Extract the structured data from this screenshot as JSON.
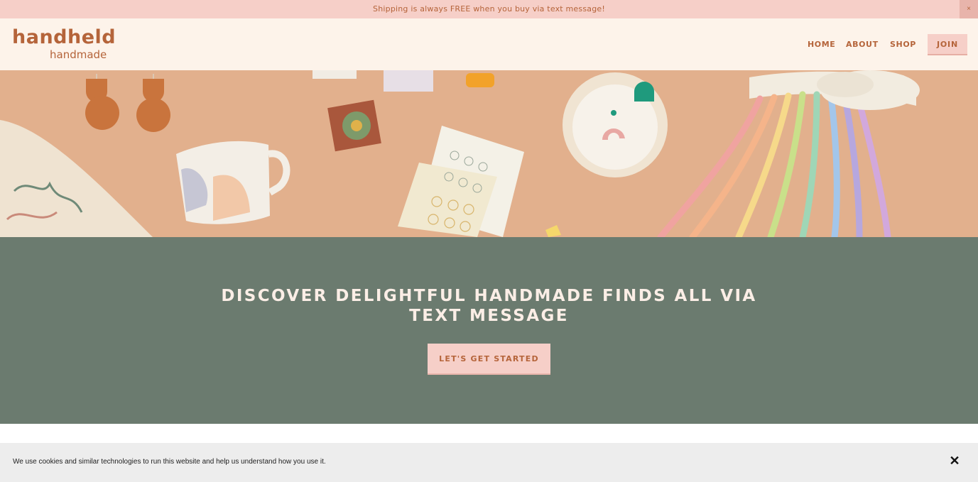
{
  "announcement": {
    "text": "Shipping is always FREE when you buy via text message!",
    "close_glyph": "×"
  },
  "header": {
    "logo_top": "handheld",
    "logo_bottom": "handmade",
    "nav": [
      "HOME",
      "ABOUT",
      "SHOP"
    ],
    "join_label": "JOIN"
  },
  "hero": {
    "image_alt": "Flat lay of handmade goods: leather earrings, ceramic mug, patterned cards, jewelry dish, rainbow yarn wall hanging",
    "background_color": "#e5b592"
  },
  "band": {
    "headline": "DISCOVER DELIGHTFUL HANDMADE FINDS ALL VIA TEXT MESSAGE",
    "cta_label": "LET'S GET STARTED"
  },
  "cookie": {
    "text": "We use cookies and similar technologies to run this website and help us understand how you use it.",
    "close_glyph": "✕"
  },
  "colors": {
    "accent": "#b5643a",
    "pink": "#f6cfc8",
    "cream": "#fdf3ea",
    "sage": "#6b7b6f"
  }
}
